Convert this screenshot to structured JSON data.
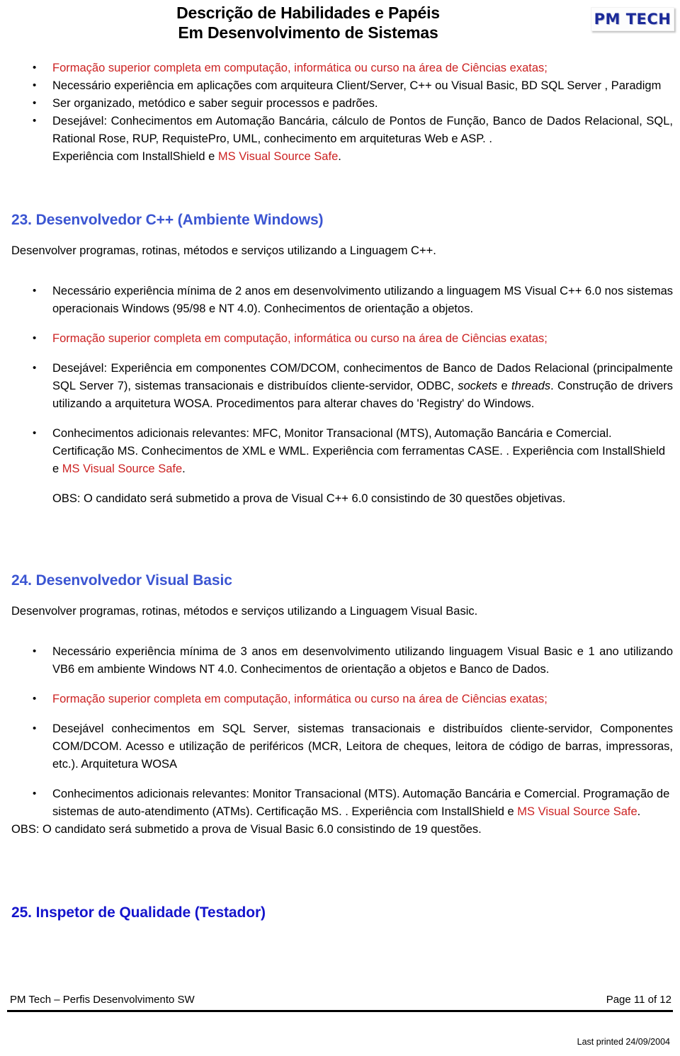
{
  "header": {
    "title_line1": "Descrição de Habilidades e Papéis",
    "title_line2": "Em Desenvolvimento de Sistemas",
    "logo_text": "PM TECH"
  },
  "top_bullets": [
    "Formação superior completa em computação, informática ou curso na área de Ciências exatas;",
    "Necessário experiência em aplicações com   arquiteura Client/Server, C++ ou Visual Basic, BD SQL Server , Paradigm",
    "Ser organizado, metódico e saber seguir processos e padrões.",
    "Desejável: Conhecimentos em Automação Bancária, cálculo de Pontos de Função, Banco de Dados Relacional, SQL, Rational Rose, RUP, RequistePro, UML, conhecimento em arquiteturas Web e ASP. ."
  ],
  "top_trailing": {
    "prefix": "Experiência com InstallShield e ",
    "red": "MS Visual Source Safe",
    "suffix": "."
  },
  "section23": {
    "heading": "23. Desenvolvedor C++  (Ambiente Windows)",
    "intro": "Desenvolver programas, rotinas, métodos e serviços utilizando a Linguagem C++.",
    "b1": "Necessário experiência mínima de 2 anos em desenvolvimento utilizando a linguagem MS Visual C++ 6.0 nos sistemas operacionais Windows (95/98 e NT 4.0). Conhecimentos de orientação a objetos.",
    "b2_red": "Formação superior completa em computação, informática ou curso na área de Ciências exatas;",
    "b3_part1": "Desejável: Experiência em componentes COM/DCOM, conhecimentos de Banco de Dados Relacional (principalmente SQL Server 7), sistemas transacionais e distribuídos cliente-servidor, ODBC, ",
    "b3_ital1": "sockets",
    "b3_part2": " e ",
    "b3_ital2": "threads",
    "b3_part3": ". Construção de drivers utilizando a arquitetura WOSA. Procedimentos para alterar chaves do 'Registry' do Windows.",
    "b4_part1": "Conhecimentos adicionais relevantes: MFC, Monitor Transacional (MTS), Automação Bancária e Comercial. Certificação MS. Conhecimentos de XML e WML. Experiência com ferramentas CASE. . Experiência com InstallShield e ",
    "b4_red": "MS Visual Source Safe",
    "b4_part2": ".",
    "obs": "OBS: O candidato será submetido a prova de Visual C++ 6.0 consistindo de 30 questões objetivas."
  },
  "section24": {
    "heading": "24. Desenvolvedor Visual Basic",
    "intro": "Desenvolver programas, rotinas, métodos e serviços utilizando a Linguagem Visual Basic.",
    "b1": "Necessário experiência mínima de 3 anos em desenvolvimento utilizando linguagem Visual Basic e 1 ano utilizando VB6 em ambiente Windows NT 4.0. Conhecimentos de orientação a objetos e Banco de Dados.",
    "b2_red": "Formação superior completa em computação, informática ou curso na área de Ciências exatas;",
    "b3": "Desejável conhecimentos em SQL Server, sistemas transacionais e distribuídos cliente-servidor, Componentes COM/DCOM. Acesso e utilização de periféricos (MCR, Leitora de cheques, leitora de código de barras, impressoras, etc.).  Arquitetura WOSA",
    "b4_part1": "Conhecimentos adicionais relevantes: Monitor Transacional (MTS). Automação Bancária e Comercial. Programação de sistemas de auto-atendimento (ATMs). Certificação MS. . Experiência com InstallShield e ",
    "b4_red": "MS Visual Source Safe",
    "b4_part2": ".",
    "obs": "OBS: O candidato será submetido a prova de Visual Basic 6.0 consistindo de 19 questões."
  },
  "section25": {
    "heading": "25. Inspetor de Qualidade (Testador)"
  },
  "footer": {
    "left": "PM Tech – Perfis Desenvolvimento SW",
    "right": "Page 11 of 12",
    "printed": "Last printed 24/09/2004"
  },
  "colors": {
    "red": "#cc2222",
    "blue_heading": "#3b55d2",
    "blue_heading_strong": "#1414cc",
    "logo_blue": "#1b2a99"
  }
}
